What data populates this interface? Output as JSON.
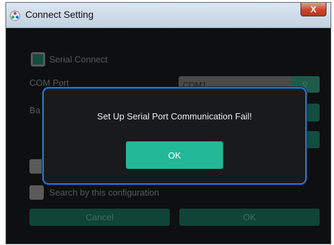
{
  "window": {
    "title": "Connect Setting",
    "close_glyph": "X",
    "icon": "app-logo-icon"
  },
  "background": {
    "serial_connect_label": "Serial Connect",
    "serial_connect_checked": true,
    "com_port_label": "COM Port",
    "com_port_value": "COM1",
    "baud_label_partial": "Ba",
    "search_label": "Search by this configuration",
    "cancel_label": "Cancel",
    "ok_label": "OK"
  },
  "dialog": {
    "message": "Set Up Serial Port Communication Fail!",
    "ok_label": "OK"
  },
  "colors": {
    "accent_green": "#23b897",
    "dialog_border": "#2d79d0",
    "window_bg": "#0e0f10"
  }
}
